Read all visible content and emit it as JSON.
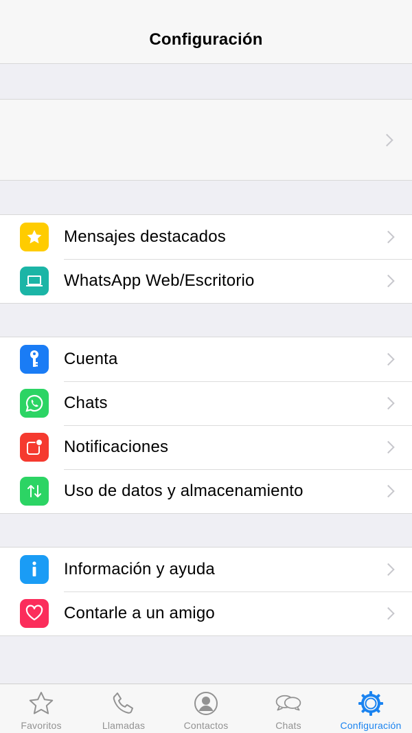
{
  "header": {
    "title": "Configuración"
  },
  "groups": {
    "g1": [
      {
        "label": "Mensajes destacados",
        "icon": "star-icon",
        "color": "#ffcc00"
      },
      {
        "label": "WhatsApp Web/Escritorio",
        "icon": "laptop-icon",
        "color": "#1bb5a6"
      }
    ],
    "g2": [
      {
        "label": "Cuenta",
        "icon": "key-icon",
        "color": "#1a7cf5"
      },
      {
        "label": "Chats",
        "icon": "whatsapp-icon",
        "color": "#2cd464"
      },
      {
        "label": "Notificaciones",
        "icon": "notification-icon",
        "color": "#f53a2f"
      },
      {
        "label": "Uso de datos y almacenamiento",
        "icon": "data-arrows-icon",
        "color": "#2cd464"
      }
    ],
    "g3": [
      {
        "label": "Información y ayuda",
        "icon": "info-icon",
        "color": "#1a9cf5"
      },
      {
        "label": "Contarle a un amigo",
        "icon": "heart-icon",
        "color": "#fb2d5b"
      }
    ]
  },
  "tabbar": {
    "favoritos": "Favoritos",
    "llamadas": "Llamadas",
    "contactos": "Contactos",
    "chats": "Chats",
    "configuracion": "Configuración",
    "active": "configuracion",
    "active_color": "#1a83f0",
    "inactive_color": "#929292"
  }
}
